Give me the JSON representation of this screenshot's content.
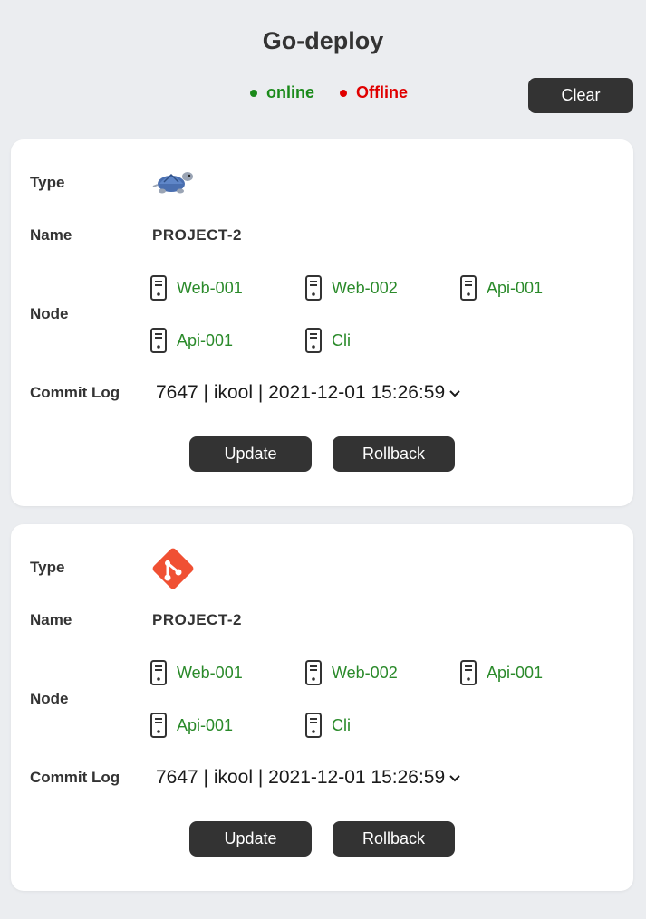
{
  "header": {
    "title": "Go-deploy",
    "legend": {
      "online_label": "online",
      "offline_label": "Offline",
      "online_color": "#1b8a1b",
      "offline_color": "#e00000"
    },
    "clear_label": "Clear"
  },
  "labels": {
    "type": "Type",
    "name": "Name",
    "node": "Node",
    "commit_log": "Commit Log",
    "update": "Update",
    "rollback": "Rollback"
  },
  "projects": [
    {
      "type_icon": "svn-tortoise-icon",
      "name": "PROJECT-2",
      "nodes": [
        {
          "label": "Web-001",
          "icon": "server-icon",
          "status": "online"
        },
        {
          "label": "Web-002",
          "icon": "server-icon",
          "status": "online"
        },
        {
          "label": "Api-001",
          "icon": "server-icon",
          "status": "online"
        },
        {
          "label": "Api-001",
          "icon": "server-icon",
          "status": "online"
        },
        {
          "label": "Cli",
          "icon": "server-icon",
          "status": "online"
        }
      ],
      "commit_log": "7647 | ikool | 2021-12-01 15:26:59"
    },
    {
      "type_icon": "git-icon",
      "name": "PROJECT-2",
      "nodes": [
        {
          "label": "Web-001",
          "icon": "server-icon",
          "status": "online"
        },
        {
          "label": "Web-002",
          "icon": "server-icon",
          "status": "online"
        },
        {
          "label": "Api-001",
          "icon": "server-icon",
          "status": "online"
        },
        {
          "label": "Api-001",
          "icon": "server-icon",
          "status": "online"
        },
        {
          "label": "Cli",
          "icon": "server-icon",
          "status": "online"
        }
      ],
      "commit_log": "7647 | ikool | 2021-12-01 15:26:59"
    }
  ]
}
